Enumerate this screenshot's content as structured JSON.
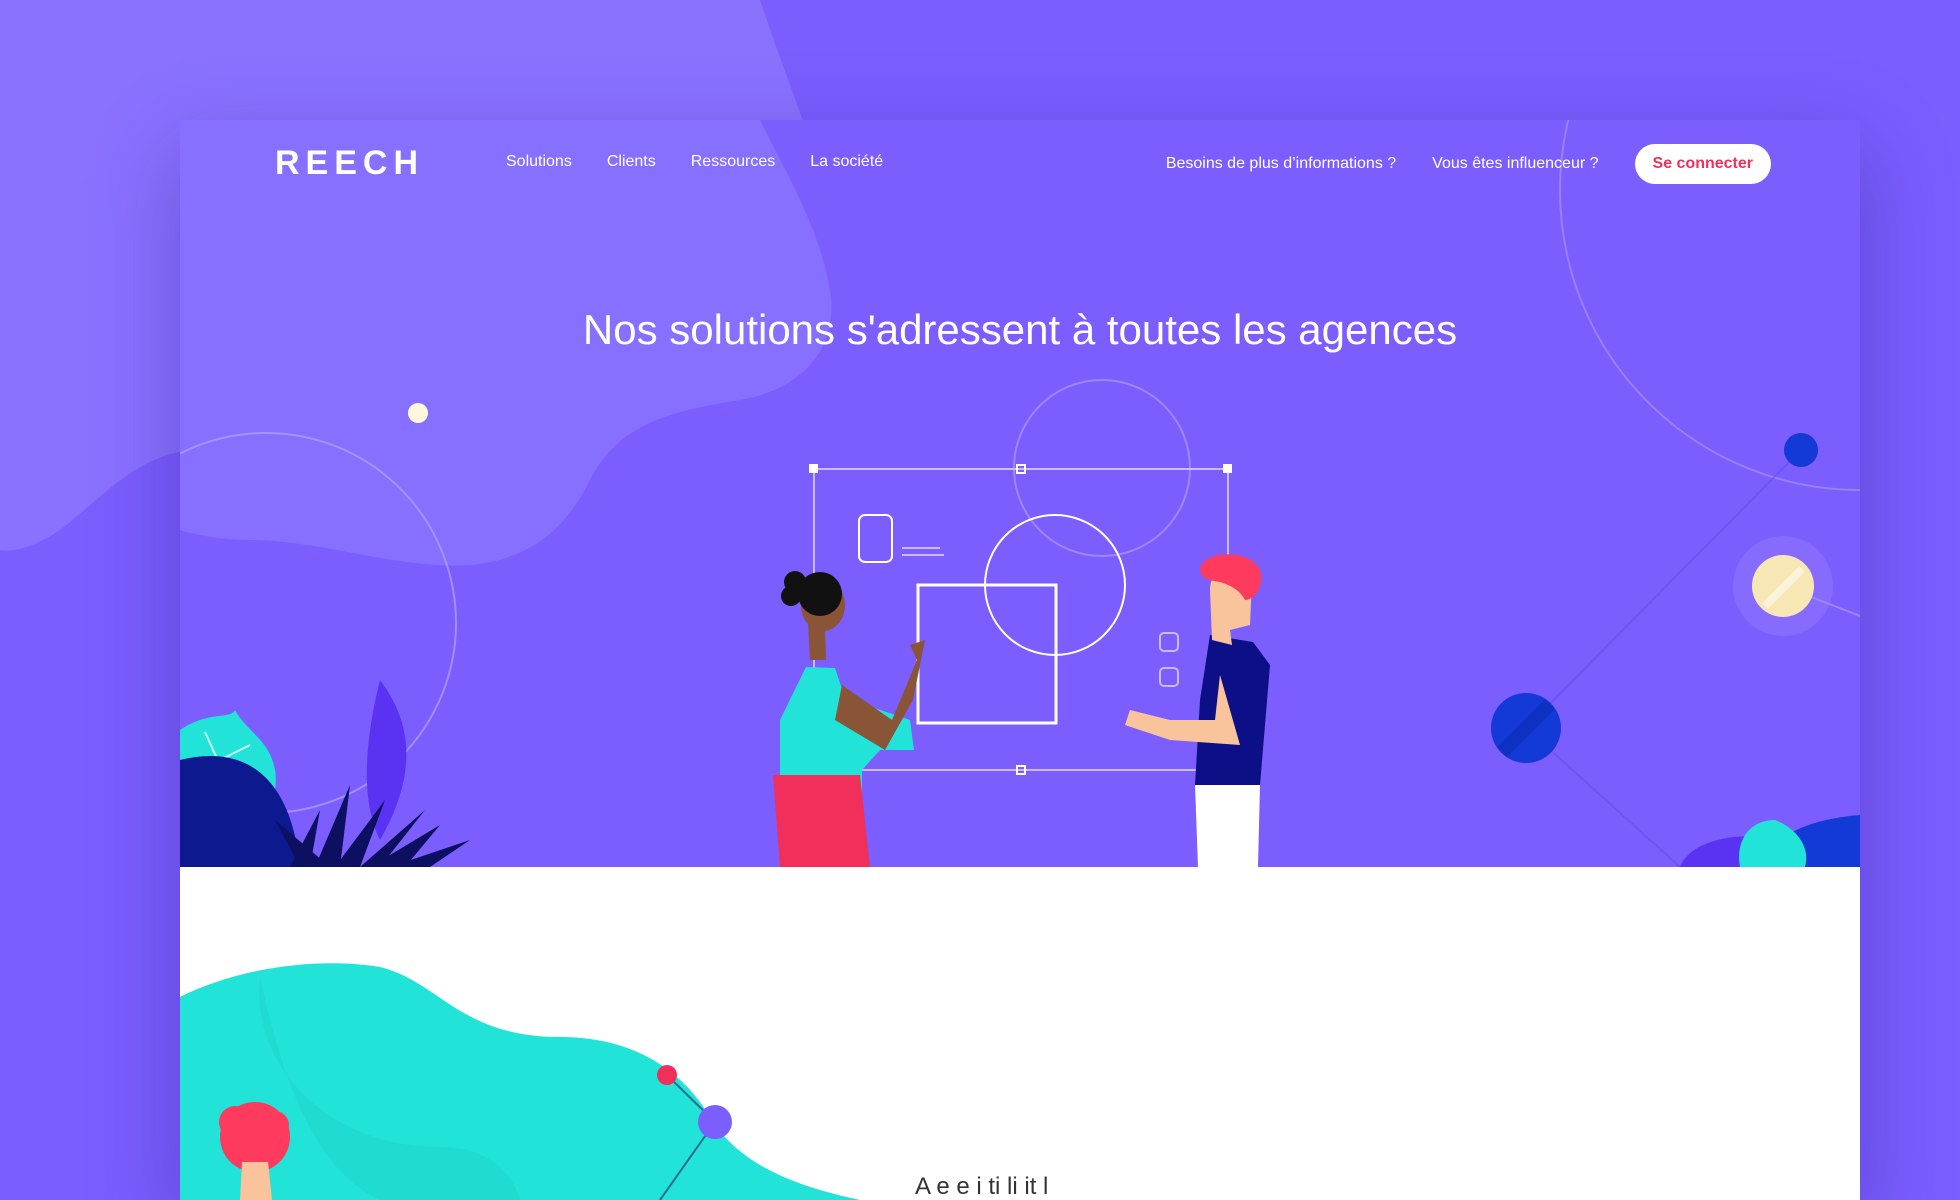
{
  "brand": {
    "logo_text": "REECH"
  },
  "nav": {
    "left_links": [
      {
        "label": "Solutions"
      },
      {
        "label": "Clients"
      },
      {
        "label": "Ressources"
      },
      {
        "label": "La société"
      }
    ],
    "right_links": [
      {
        "label": "Besoins de plus d’informations ?"
      },
      {
        "label": "Vous êtes influenceur ?"
      }
    ],
    "login_label": "Se connecter"
  },
  "hero": {
    "title": "Nos solutions s'adressent à toutes les agences"
  },
  "lower": {
    "partial_text": "A e          e          i  ti                  li  it  l"
  },
  "colors": {
    "background": "#7b5efd",
    "accent_red": "#f0305b",
    "teal": "#22e3d8",
    "navy": "#0d0f86",
    "royal_blue": "#1339d6",
    "cream": "#f6e7b5"
  }
}
